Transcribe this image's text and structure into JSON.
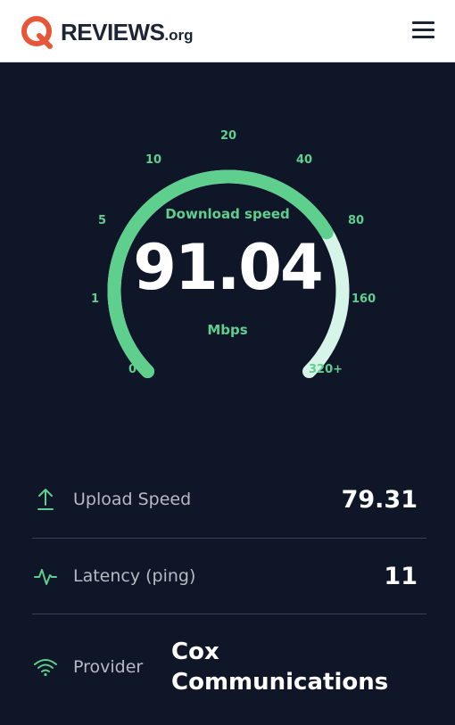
{
  "header": {
    "logo_main": "REVIEWS",
    "logo_tld": ".org",
    "menu_icon": "hamburger-menu-icon"
  },
  "gauge": {
    "title": "Download speed",
    "value": "91.04",
    "unit": "Mbps",
    "ticks": [
      "0",
      "1",
      "5",
      "10",
      "20",
      "40",
      "80",
      "160",
      "320+"
    ],
    "fill_level": 0.72,
    "colors": {
      "fill": "#5fcf8e",
      "track": "#d6f5e8"
    }
  },
  "stats": {
    "upload": {
      "label": "Upload Speed",
      "value": "79.31",
      "icon": "upload-arrow-icon"
    },
    "latency": {
      "label": "Latency (ping)",
      "value": "11",
      "icon": "pulse-icon"
    },
    "provider": {
      "label": "Provider",
      "value": "Cox Communications",
      "icon": "wifi-icon"
    }
  },
  "colors": {
    "background": "#0f1628",
    "accent": "#5fcf8e",
    "brand": "#e8563a"
  }
}
